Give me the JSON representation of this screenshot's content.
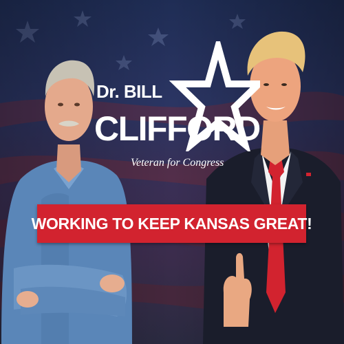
{
  "headline": {
    "prefix": "Dr. BILL",
    "name": "CLIFFORD",
    "tagline": "Veteran for Congress"
  },
  "banner": {
    "text": "WORKING TO KEEP KANSAS GREAT!",
    "color": "#d2232f"
  },
  "colors": {
    "background_navy": "#1f2d55",
    "text_white": "#ffffff",
    "banner_red": "#d2232f"
  },
  "icons": {
    "star": "star-outline-icon"
  }
}
